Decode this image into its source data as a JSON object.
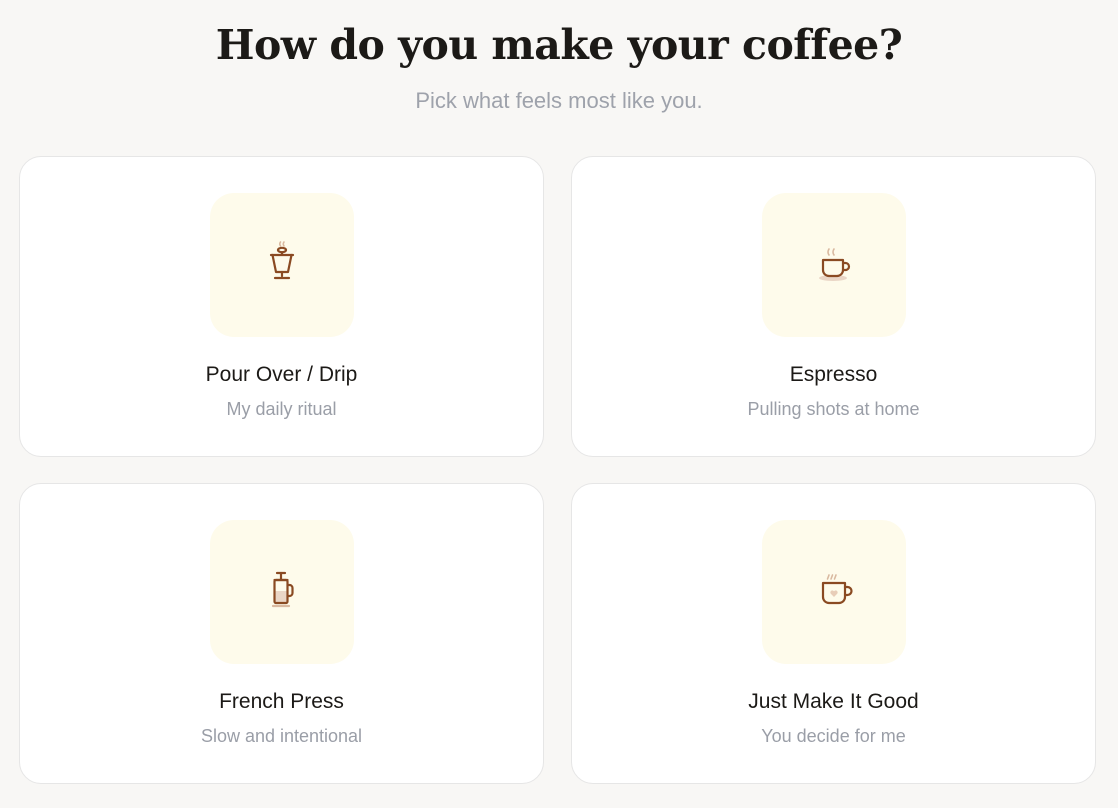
{
  "header": {
    "title": "How do you make your coffee?",
    "subtitle": "Pick what feels most like you."
  },
  "options": [
    {
      "title": "Pour Over / Drip",
      "subtitle": "My daily ritual",
      "icon": "pour-over-icon"
    },
    {
      "title": "Espresso",
      "subtitle": "Pulling shots at home",
      "icon": "espresso-cup-icon"
    },
    {
      "title": "French Press",
      "subtitle": "Slow and intentional",
      "icon": "french-press-icon"
    },
    {
      "title": "Just Make It Good",
      "subtitle": "You decide for me",
      "icon": "heart-mug-icon"
    }
  ],
  "colors": {
    "background": "#f8f7f5",
    "card": "#ffffff",
    "card_border": "#e6e6e6",
    "icon_tile": "#fefbeb",
    "icon_stroke": "#8a4a22",
    "icon_accent": "#e2c6b0",
    "title_text": "#1c1a17",
    "muted_text": "#9ea2ab"
  }
}
